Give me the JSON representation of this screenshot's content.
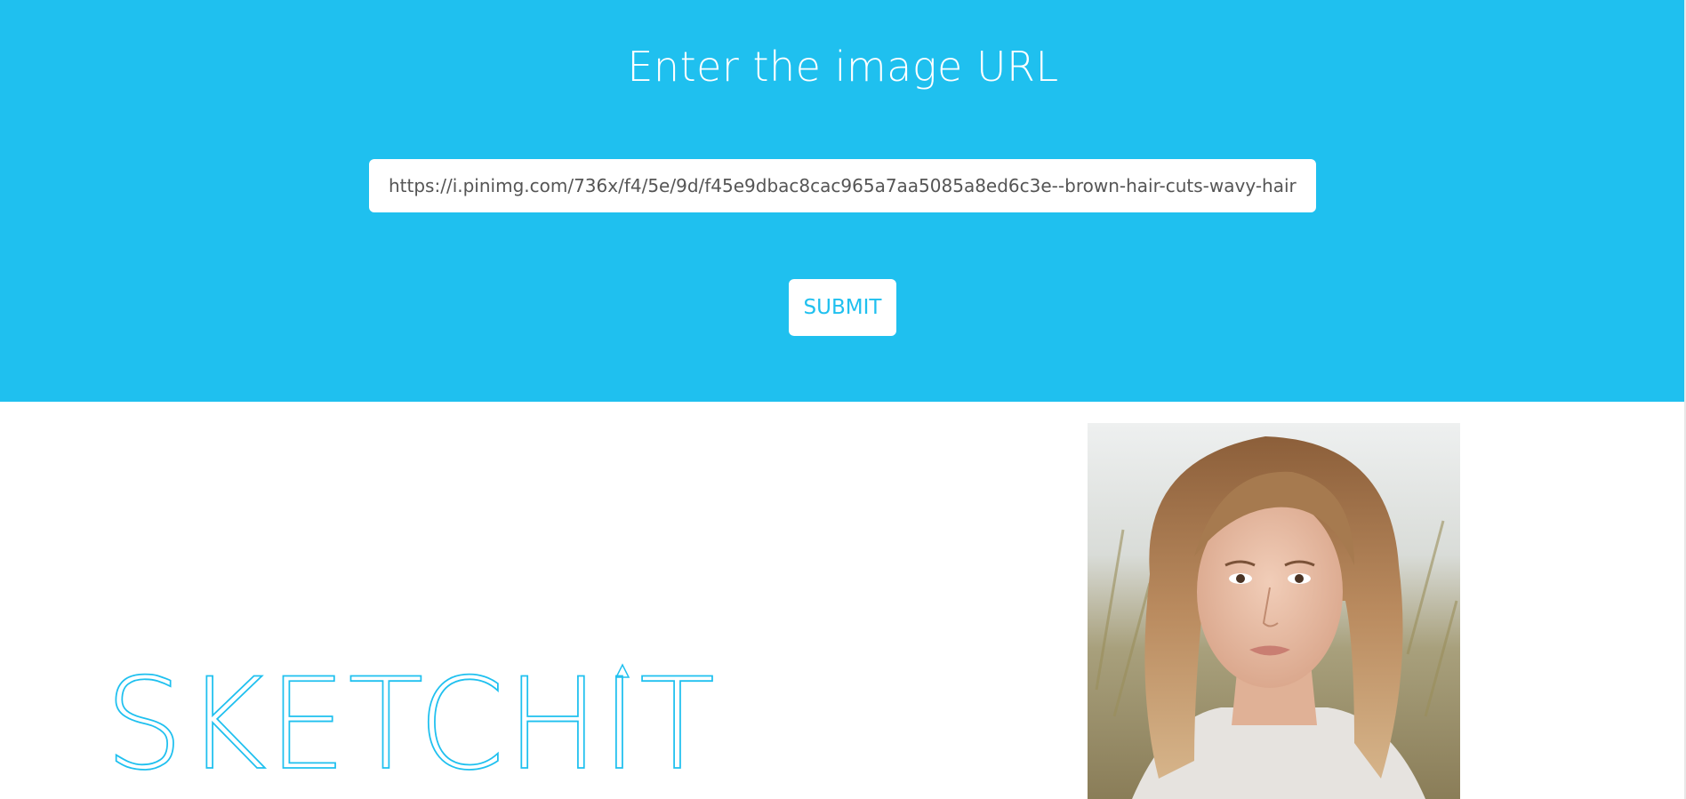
{
  "header": {
    "title": "Enter the image URL"
  },
  "form": {
    "url_value": "https://i.pinimg.com/736x/f4/5e/9d/f45e9dbac8cac965a7aa5085a8ed6c3e--brown-hair-cuts-wavy-hair",
    "submit_label": "SUBMIT"
  },
  "logo": {
    "text": "SKETCHIT"
  },
  "colors": {
    "accent": "#1fc0ef",
    "background": "#ffffff",
    "text_on_accent": "#ffffff"
  },
  "preview": {
    "icon": "portrait-photo"
  }
}
